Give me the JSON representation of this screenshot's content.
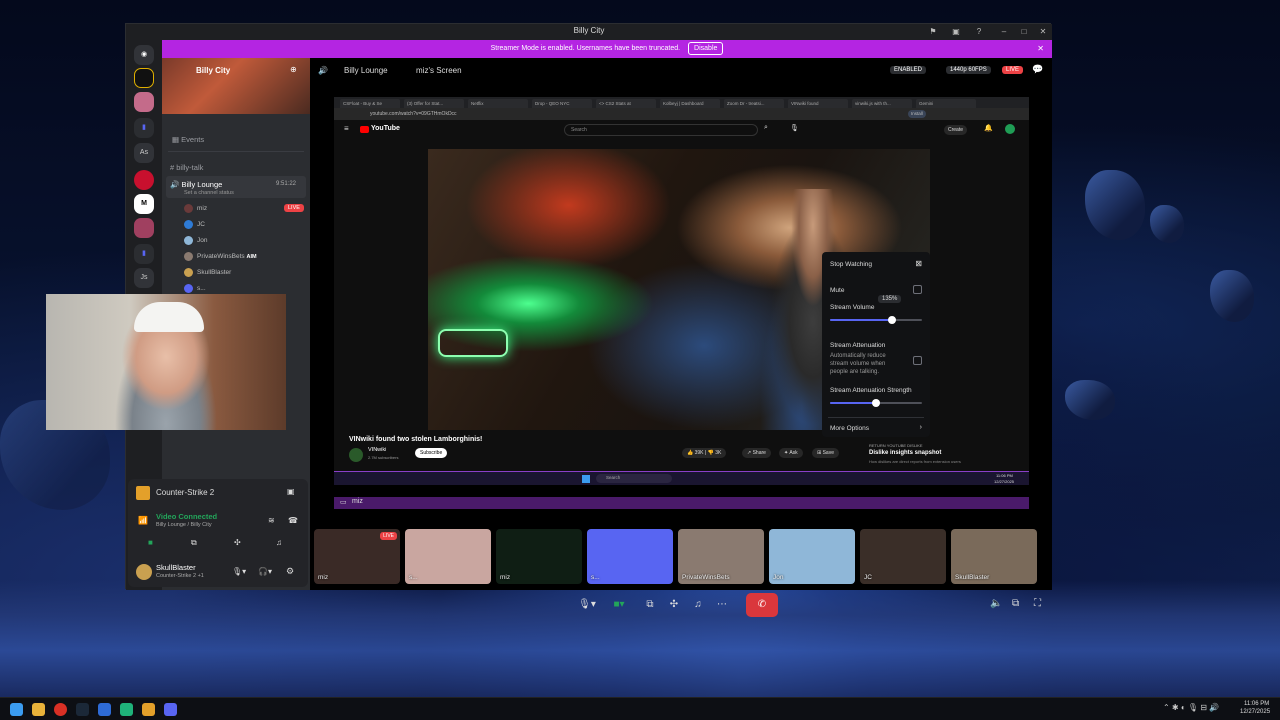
{
  "window": {
    "title": "Billy City"
  },
  "banner": {
    "text": "Streamer Mode is enabled. Usernames have been truncated.",
    "button": "Disable"
  },
  "servers": {
    "items": [
      "As",
      "Js"
    ]
  },
  "channels": {
    "server_name": "Billy City",
    "events": "Events",
    "text_channel": "billy-talk",
    "voice_channel": "Billy Lounge",
    "voice_time": "9:51:22",
    "voice_status": "Set a channel status",
    "voice_users": [
      {
        "name": "miz",
        "badge": "LIVE"
      },
      {
        "name": "JC",
        "badge": ""
      },
      {
        "name": "Jon",
        "badge": ""
      },
      {
        "name": "PrivateWinsBets",
        "badge": "AIM"
      },
      {
        "name": "SkullBlaster",
        "badge": ""
      },
      {
        "name": "s...",
        "badge": ""
      }
    ]
  },
  "stage": {
    "channel": "Billy Lounge",
    "screen": "miz's Screen",
    "enabled": "ENABLED",
    "quality": "1440p 60FPS",
    "live": "LIVE"
  },
  "browser": {
    "tabs": [
      "CSFloat - Buy & Se",
      "(3) Offer for Stat...",
      "Netflix",
      "Drop - QEO NYC",
      "<> CS2 Stats at",
      "Kolbeyj | Dashboard",
      "Zoom Dr - treatsi...",
      "VINwiki found",
      "vinwiki.js with th...",
      "Gemini"
    ],
    "url": "youtube.com/watch?v=09GTHmOkDcc",
    "install": "Install",
    "youtube": "YouTube",
    "search_placeholder": "Search",
    "create": "Create",
    "video_title": "VINwiki found two stolen Lamborghinis!",
    "channel": "VINwiki",
    "subscribers": "2.7M subscribers",
    "subscribe": "Subscribe",
    "likes": "39K",
    "dislikes": "3K",
    "share": "Share",
    "ask": "Ask",
    "save": "Save",
    "promo_label": "RETURN YOUTUBE DISLIKE",
    "promo_title": "Dislike insights snapshot",
    "promo_text": "How dislikes are direct reports from extension users",
    "taskbar_search": "Search",
    "taskbar_time": "11:06 PM",
    "taskbar_date": "12/27/2025"
  },
  "popup": {
    "stop": "Stop Watching",
    "mute": "Mute",
    "volume_label": "Stream Volume",
    "volume_value": "135%",
    "volume_fraction": 0.67,
    "attenuation": "Stream Attenuation",
    "attenuation_desc": "Automatically reduce stream volume when people are talking.",
    "strength": "Stream Attenuation Strength",
    "strength_fraction": 0.5,
    "more": "More Options"
  },
  "share_bar": {
    "name": "miz"
  },
  "tiles": [
    {
      "name": "miz",
      "live": "LIVE",
      "color": "#3a2a26"
    },
    {
      "name": "s...",
      "live": "",
      "color": "#c9a6a0"
    },
    {
      "name": "miz",
      "live": "",
      "color": "#0f1e14"
    },
    {
      "name": "s...",
      "live": "",
      "color": "#5865f2"
    },
    {
      "name": "PrivateWinsBets",
      "live": "",
      "color": "#8a7a70"
    },
    {
      "name": "Jon",
      "live": "",
      "color": "#8fb7d8"
    },
    {
      "name": "JC",
      "live": "",
      "color": "#3a2e28"
    },
    {
      "name": "SkullBlaster",
      "live": "",
      "color": "#7a6a5a"
    }
  ],
  "activity": {
    "game": "Counter-Strike 2"
  },
  "voice_panel": {
    "status": "Video Connected",
    "location": "Billy Lounge / Billy City"
  },
  "user": {
    "name": "SkullBlaster",
    "status": "Counter-Strike 2 +1"
  },
  "system": {
    "time": "11:06 PM",
    "date": "12/27/2025"
  },
  "colors": {
    "brand": "#5865f2",
    "banner": "#b425e2",
    "live": "#ed4245",
    "connected": "#23a55a"
  }
}
